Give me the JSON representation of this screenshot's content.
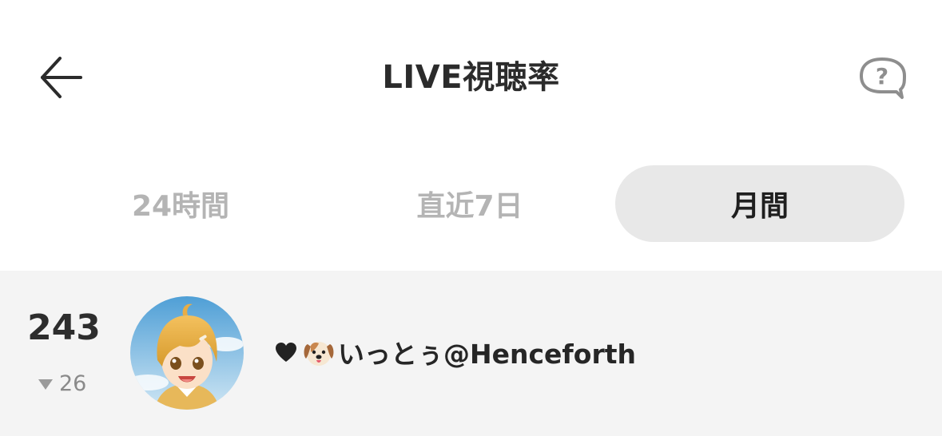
{
  "header": {
    "title": "LIVE視聴率",
    "back_icon": "arrow-left-icon",
    "help_icon": "question-bubble-icon"
  },
  "tabs": [
    {
      "label": "24時間",
      "active": false
    },
    {
      "label": "直近7日",
      "active": false
    },
    {
      "label": "月間",
      "active": true
    }
  ],
  "ranking": [
    {
      "rank": "243",
      "change_direction": "down",
      "change": "26",
      "name": "いっとぅ@Henceforth",
      "name_prefix_icons": [
        "heart-icon",
        "dog-face-icon"
      ]
    }
  ],
  "colors": {
    "background": "#ffffff",
    "row_background": "#f4f4f4",
    "active_tab_background": "#e8e8e8",
    "inactive_tab_text": "#b4b4b4",
    "primary_text": "#2b2b2b"
  }
}
